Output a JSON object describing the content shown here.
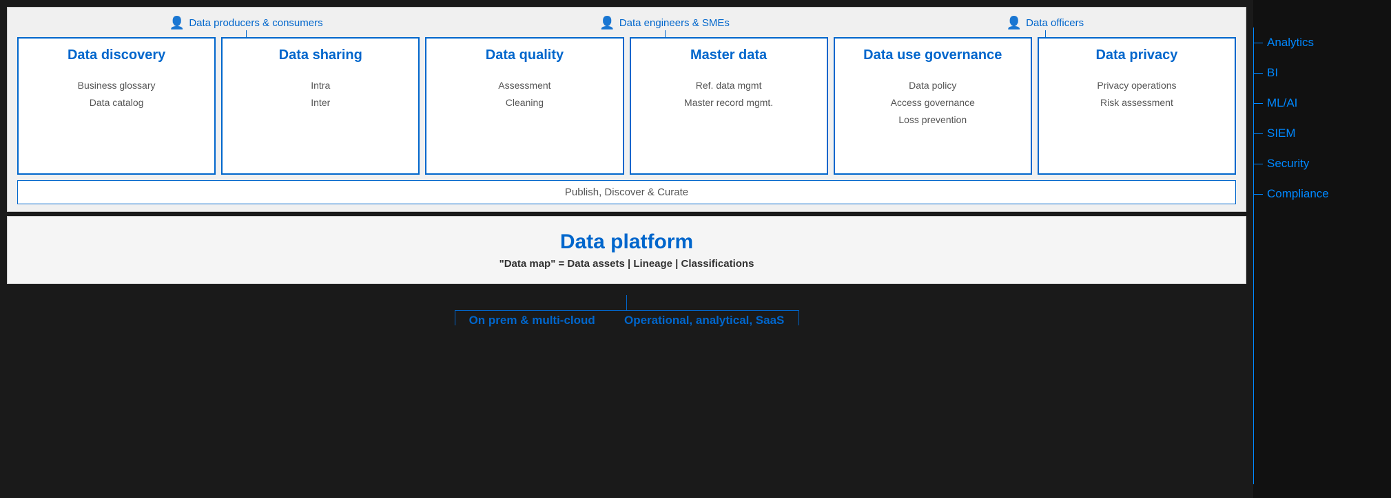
{
  "personas": [
    {
      "id": "producers",
      "label": "Data producers & consumers"
    },
    {
      "id": "engineers",
      "label": "Data engineers & SMEs"
    },
    {
      "id": "officers",
      "label": "Data officers"
    }
  ],
  "boxes": [
    {
      "id": "data-discovery",
      "title": "Data discovery",
      "items": [
        "Business glossary",
        "Data catalog"
      ]
    },
    {
      "id": "data-sharing",
      "title": "Data sharing",
      "items": [
        "Intra",
        "Inter"
      ]
    },
    {
      "id": "data-quality",
      "title": "Data quality",
      "items": [
        "Assessment",
        "Cleaning"
      ]
    },
    {
      "id": "master-data",
      "title": "Master data",
      "items": [
        "Ref. data mgmt",
        "Master record mgmt."
      ]
    },
    {
      "id": "data-use-governance",
      "title": "Data use governance",
      "items": [
        "Data policy",
        "Access governance",
        "Loss prevention"
      ]
    },
    {
      "id": "data-privacy",
      "title": "Data privacy",
      "items": [
        "Privacy operations",
        "Risk assessment"
      ]
    }
  ],
  "publish_bar": "Publish, Discover & Curate",
  "platform": {
    "title": "Data platform",
    "subtitle": "\"Data map\" = Data assets | Lineage | Classifications"
  },
  "bottom_items": [
    {
      "id": "on-prem",
      "label": "On prem & multi-cloud"
    },
    {
      "id": "operational",
      "label": "Operational, analytical, SaaS"
    }
  ],
  "sidebar": {
    "items": [
      {
        "id": "analytics",
        "label": "Analytics"
      },
      {
        "id": "bi",
        "label": "BI"
      },
      {
        "id": "ml-ai",
        "label": "ML/AI"
      },
      {
        "id": "siem",
        "label": "SIEM"
      },
      {
        "id": "security",
        "label": "Security"
      },
      {
        "id": "compliance",
        "label": "Compliance"
      }
    ]
  },
  "accent_color": "#0066cc"
}
